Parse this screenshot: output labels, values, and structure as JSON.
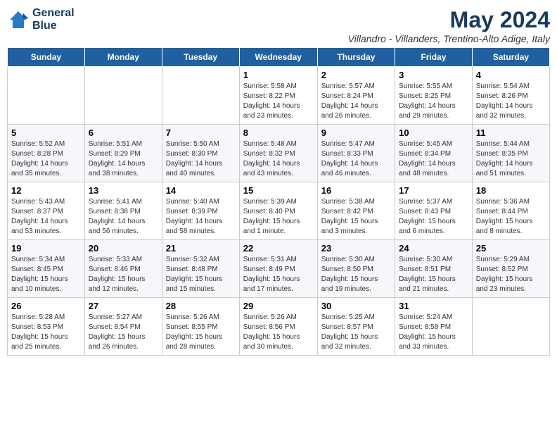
{
  "header": {
    "logo_line1": "General",
    "logo_line2": "Blue",
    "title": "May 2024",
    "subtitle": "Villandro - Villanders, Trentino-Alto Adige, Italy"
  },
  "days": [
    "Sunday",
    "Monday",
    "Tuesday",
    "Wednesday",
    "Thursday",
    "Friday",
    "Saturday"
  ],
  "weeks": [
    [
      {
        "date": "",
        "info": ""
      },
      {
        "date": "",
        "info": ""
      },
      {
        "date": "",
        "info": ""
      },
      {
        "date": "1",
        "info": "Sunrise: 5:58 AM\nSunset: 8:22 PM\nDaylight: 14 hours\nand 23 minutes."
      },
      {
        "date": "2",
        "info": "Sunrise: 5:57 AM\nSunset: 8:24 PM\nDaylight: 14 hours\nand 26 minutes."
      },
      {
        "date": "3",
        "info": "Sunrise: 5:55 AM\nSunset: 8:25 PM\nDaylight: 14 hours\nand 29 minutes."
      },
      {
        "date": "4",
        "info": "Sunrise: 5:54 AM\nSunset: 8:26 PM\nDaylight: 14 hours\nand 32 minutes."
      }
    ],
    [
      {
        "date": "5",
        "info": "Sunrise: 5:52 AM\nSunset: 8:28 PM\nDaylight: 14 hours\nand 35 minutes."
      },
      {
        "date": "6",
        "info": "Sunrise: 5:51 AM\nSunset: 8:29 PM\nDaylight: 14 hours\nand 38 minutes."
      },
      {
        "date": "7",
        "info": "Sunrise: 5:50 AM\nSunset: 8:30 PM\nDaylight: 14 hours\nand 40 minutes."
      },
      {
        "date": "8",
        "info": "Sunrise: 5:48 AM\nSunset: 8:32 PM\nDaylight: 14 hours\nand 43 minutes."
      },
      {
        "date": "9",
        "info": "Sunrise: 5:47 AM\nSunset: 8:33 PM\nDaylight: 14 hours\nand 46 minutes."
      },
      {
        "date": "10",
        "info": "Sunrise: 5:45 AM\nSunset: 8:34 PM\nDaylight: 14 hours\nand 48 minutes."
      },
      {
        "date": "11",
        "info": "Sunrise: 5:44 AM\nSunset: 8:35 PM\nDaylight: 14 hours\nand 51 minutes."
      }
    ],
    [
      {
        "date": "12",
        "info": "Sunrise: 5:43 AM\nSunset: 8:37 PM\nDaylight: 14 hours\nand 53 minutes."
      },
      {
        "date": "13",
        "info": "Sunrise: 5:41 AM\nSunset: 8:38 PM\nDaylight: 14 hours\nand 56 minutes."
      },
      {
        "date": "14",
        "info": "Sunrise: 5:40 AM\nSunset: 8:39 PM\nDaylight: 14 hours\nand 58 minutes."
      },
      {
        "date": "15",
        "info": "Sunrise: 5:39 AM\nSunset: 8:40 PM\nDaylight: 15 hours\nand 1 minute."
      },
      {
        "date": "16",
        "info": "Sunrise: 5:38 AM\nSunset: 8:42 PM\nDaylight: 15 hours\nand 3 minutes."
      },
      {
        "date": "17",
        "info": "Sunrise: 5:37 AM\nSunset: 8:43 PM\nDaylight: 15 hours\nand 6 minutes."
      },
      {
        "date": "18",
        "info": "Sunrise: 5:36 AM\nSunset: 8:44 PM\nDaylight: 15 hours\nand 8 minutes."
      }
    ],
    [
      {
        "date": "19",
        "info": "Sunrise: 5:34 AM\nSunset: 8:45 PM\nDaylight: 15 hours\nand 10 minutes."
      },
      {
        "date": "20",
        "info": "Sunrise: 5:33 AM\nSunset: 8:46 PM\nDaylight: 15 hours\nand 12 minutes."
      },
      {
        "date": "21",
        "info": "Sunrise: 5:32 AM\nSunset: 8:48 PM\nDaylight: 15 hours\nand 15 minutes."
      },
      {
        "date": "22",
        "info": "Sunrise: 5:31 AM\nSunset: 8:49 PM\nDaylight: 15 hours\nand 17 minutes."
      },
      {
        "date": "23",
        "info": "Sunrise: 5:30 AM\nSunset: 8:50 PM\nDaylight: 15 hours\nand 19 minutes."
      },
      {
        "date": "24",
        "info": "Sunrise: 5:30 AM\nSunset: 8:51 PM\nDaylight: 15 hours\nand 21 minutes."
      },
      {
        "date": "25",
        "info": "Sunrise: 5:29 AM\nSunset: 8:52 PM\nDaylight: 15 hours\nand 23 minutes."
      }
    ],
    [
      {
        "date": "26",
        "info": "Sunrise: 5:28 AM\nSunset: 8:53 PM\nDaylight: 15 hours\nand 25 minutes."
      },
      {
        "date": "27",
        "info": "Sunrise: 5:27 AM\nSunset: 8:54 PM\nDaylight: 15 hours\nand 26 minutes."
      },
      {
        "date": "28",
        "info": "Sunrise: 5:26 AM\nSunset: 8:55 PM\nDaylight: 15 hours\nand 28 minutes."
      },
      {
        "date": "29",
        "info": "Sunrise: 5:26 AM\nSunset: 8:56 PM\nDaylight: 15 hours\nand 30 minutes."
      },
      {
        "date": "30",
        "info": "Sunrise: 5:25 AM\nSunset: 8:57 PM\nDaylight: 15 hours\nand 32 minutes."
      },
      {
        "date": "31",
        "info": "Sunrise: 5:24 AM\nSunset: 8:58 PM\nDaylight: 15 hours\nand 33 minutes."
      },
      {
        "date": "",
        "info": ""
      }
    ]
  ]
}
